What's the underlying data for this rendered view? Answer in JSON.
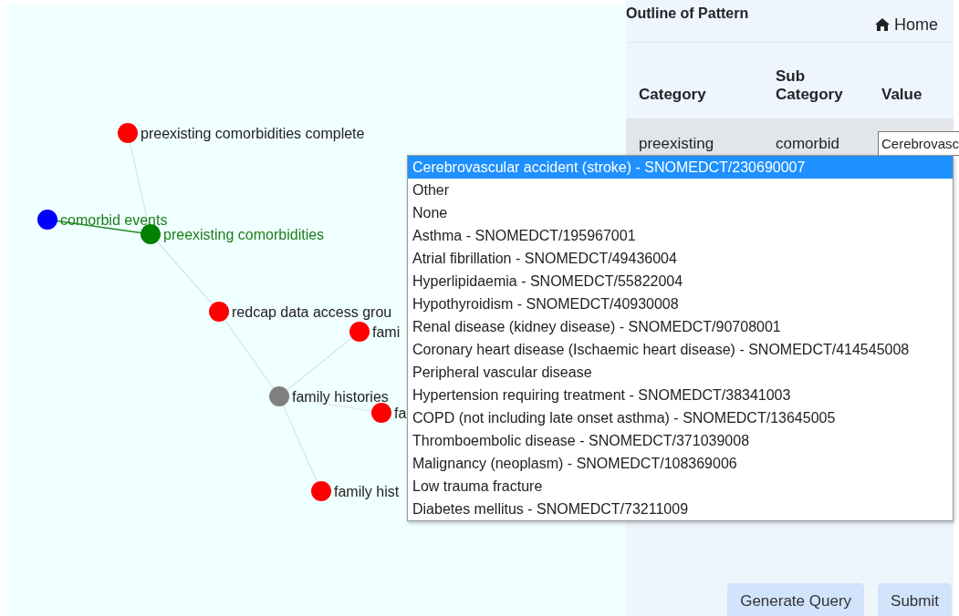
{
  "graph": {
    "nodes": [
      {
        "label": "preexisting comorbidities complete",
        "color": "#ff0000",
        "highlighted": false
      },
      {
        "label": "comorbid events",
        "color": "#0000ff",
        "highlighted": true
      },
      {
        "label": "preexisting comorbidities",
        "color": "#008000",
        "highlighted": true
      },
      {
        "label": "redcap data access grou",
        "color": "#ff0000",
        "highlighted": false
      },
      {
        "label": "fami",
        "color": "#ff0000",
        "highlighted": false
      },
      {
        "label": "family histories",
        "color": "#808080",
        "highlighted": false
      },
      {
        "label": "fa",
        "color": "#ff0000",
        "highlighted": false
      },
      {
        "label": "family hist",
        "color": "#ff0000",
        "highlighted": false
      }
    ],
    "edges": [
      {
        "highlighted": true
      },
      {
        "highlighted": false
      },
      {
        "highlighted": false
      },
      {
        "highlighted": false
      },
      {
        "highlighted": false
      },
      {
        "highlighted": false
      },
      {
        "highlighted": false
      }
    ]
  },
  "panel": {
    "title": "Outline of Pattern",
    "home_link": "Home",
    "table": {
      "columns": [
        "Category",
        "Sub Category",
        "Value"
      ],
      "rows": [
        {
          "category": "preexisting",
          "sub_category": "comorbid",
          "value": "Cerebrovasc"
        }
      ]
    },
    "dropdown": {
      "options": [
        {
          "label": "Cerebrovascular accident (stroke) - SNOMEDCT/230690007",
          "selected": true
        },
        {
          "label": "Other",
          "selected": false
        },
        {
          "label": "None",
          "selected": false
        },
        {
          "label": "Asthma - SNOMEDCT/195967001",
          "selected": false
        },
        {
          "label": "Atrial fibrillation - SNOMEDCT/49436004",
          "selected": false
        },
        {
          "label": "Hyperlipidaemia - SNOMEDCT/55822004",
          "selected": false
        },
        {
          "label": "Hypothyroidism - SNOMEDCT/40930008",
          "selected": false
        },
        {
          "label": "Renal disease (kidney disease) - SNOMEDCT/90708001",
          "selected": false
        },
        {
          "label": "Coronary heart disease (Ischaemic heart disease) - SNOMEDCT/414545008",
          "selected": false
        },
        {
          "label": "Peripheral vascular disease",
          "selected": false
        },
        {
          "label": "Hypertension requiring treatment - SNOMEDCT/38341003",
          "selected": false
        },
        {
          "label": "COPD (not including late onset asthma) - SNOMEDCT/13645005",
          "selected": false
        },
        {
          "label": "Thromboembolic disease - SNOMEDCT/371039008",
          "selected": false
        },
        {
          "label": "Malignancy (neoplasm) - SNOMEDCT/108369006",
          "selected": false
        },
        {
          "label": "Low trauma fracture",
          "selected": false
        },
        {
          "label": "Diabetes mellitus - SNOMEDCT/73211009",
          "selected": false
        }
      ]
    },
    "buttons": [
      "Generate Query",
      "Submit"
    ]
  }
}
